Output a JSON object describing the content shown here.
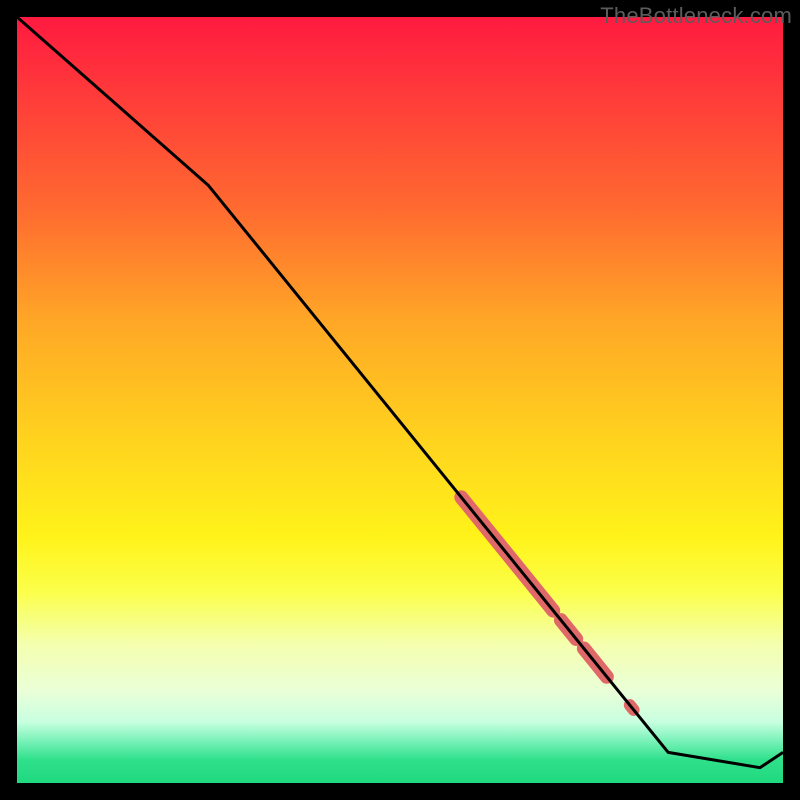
{
  "watermark": "TheBottleneck.com",
  "colors": {
    "line": "#000000",
    "highlight": "#e06868",
    "background_top": "#ff1a40",
    "background_bottom": "#1fd97f"
  },
  "chart_data": {
    "type": "line",
    "title": "",
    "xlabel": "",
    "ylabel": "",
    "xlim": [
      0,
      100
    ],
    "ylim": [
      0,
      100
    ],
    "series": [
      {
        "name": "curve",
        "x": [
          0,
          25,
          85,
          97,
          100
        ],
        "values": [
          100,
          78,
          4,
          2,
          4
        ]
      }
    ],
    "highlighted_segments": [
      {
        "x_start": 58,
        "x_end": 70,
        "thick": true
      },
      {
        "x_start": 71,
        "x_end": 73,
        "thick": true
      },
      {
        "x_start": 74,
        "x_end": 77,
        "thick": true
      },
      {
        "x_start": 80,
        "x_end": 80.5,
        "thick": false
      }
    ]
  }
}
